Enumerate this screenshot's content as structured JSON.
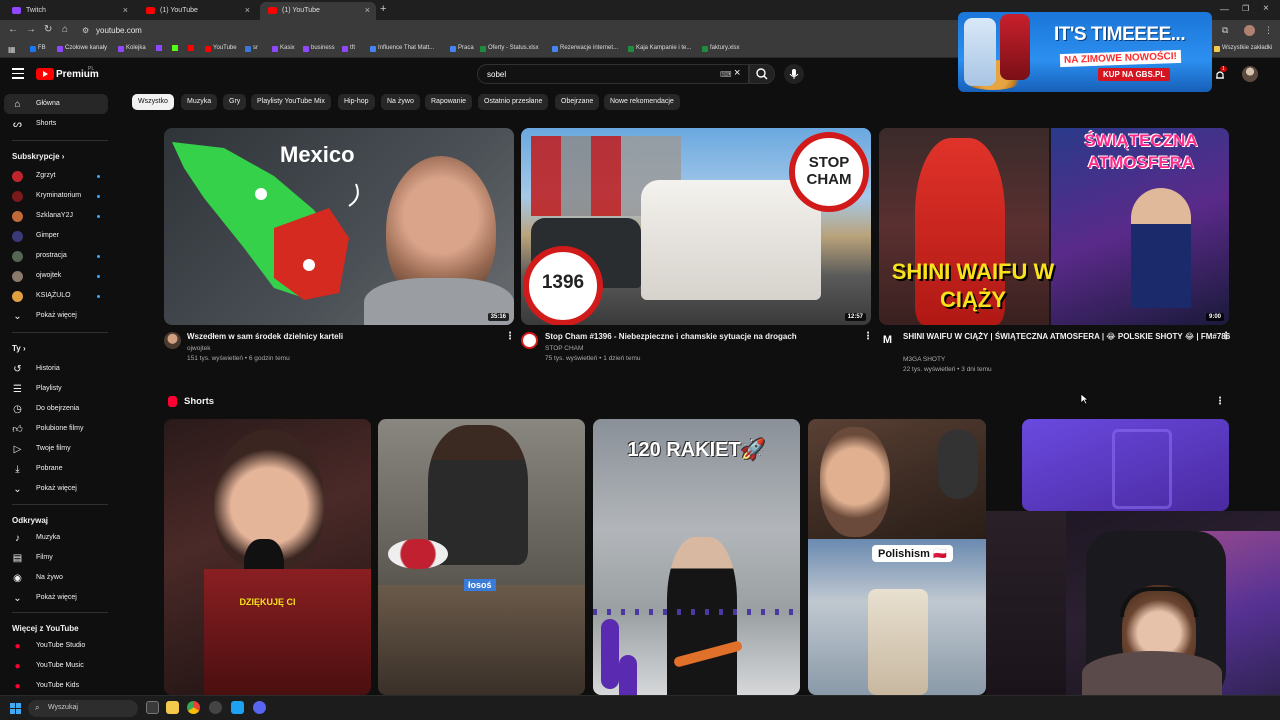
{
  "browser": {
    "tabs": [
      {
        "label": "Twitch",
        "active": false
      },
      {
        "label": "(1) YouTube",
        "active": false
      },
      {
        "label": "(1) YouTube",
        "active": true
      }
    ],
    "url": "youtube.com",
    "bookmarks": [
      "FB",
      "Czołowe kanały",
      "Kolejka",
      "YouTube",
      "sr",
      "Kasix",
      "business",
      "tft",
      "Influence That Matt...",
      "Praca",
      "Oferty - Status.xlsx",
      "Rezerwacje internet...",
      "Kaja Kampanie i te...",
      "faktury.xlsx",
      "Wszystkie zakładki"
    ]
  },
  "header": {
    "logo_text": "Premium",
    "logo_region": "PL",
    "search_value": "sobel",
    "bell_badge": "1"
  },
  "ad": {
    "title": "IT'S TIMEEEE...",
    "subtitle": "NA ZIMOWE NOWOŚCI!",
    "cta": "KUP NA GBS.PL"
  },
  "sidebar": {
    "main": [
      {
        "label": "Główna",
        "icon": "home-icon"
      },
      {
        "label": "Shorts",
        "icon": "shorts-icon"
      }
    ],
    "subs_title": "Subskrypcje",
    "subs": [
      {
        "label": "Zgrzyt",
        "color": "#c0242c",
        "dot": true
      },
      {
        "label": "Kryminatorium",
        "color": "#7a1a1a",
        "dot": true
      },
      {
        "label": "SzklanaY2J",
        "color": "#c06a3a",
        "dot": true
      },
      {
        "label": "Gimper",
        "color": "#3a3a7a",
        "dot": false
      },
      {
        "label": "prostracja",
        "color": "#556655",
        "dot": true
      },
      {
        "label": "ojwojtek",
        "color": "#8a7a6a",
        "dot": true
      },
      {
        "label": "KSIĄŻULO",
        "color": "#e0a040",
        "dot": true
      }
    ],
    "subs_more": "Pokaż więcej",
    "you_title": "Ty",
    "you": [
      {
        "label": "Historia",
        "icon": "history-icon"
      },
      {
        "label": "Playlisty",
        "icon": "playlist-icon"
      },
      {
        "label": "Do obejrzenia",
        "icon": "clock-icon"
      },
      {
        "label": "Polubione filmy",
        "icon": "like-icon"
      },
      {
        "label": "Twoje filmy",
        "icon": "video-icon"
      },
      {
        "label": "Pobrane",
        "icon": "download-icon"
      }
    ],
    "you_more": "Pokaż więcej",
    "explore_title": "Odkrywaj",
    "explore": [
      {
        "label": "Muzyka",
        "icon": "music-icon"
      },
      {
        "label": "Filmy",
        "icon": "film-icon"
      },
      {
        "label": "Na żywo",
        "icon": "live-icon"
      }
    ],
    "explore_more": "Pokaż więcej",
    "more_title": "Więcej z YouTube",
    "more": [
      {
        "label": "YouTube Studio"
      },
      {
        "label": "YouTube Music"
      },
      {
        "label": "YouTube Kids"
      }
    ]
  },
  "chips": [
    "Wszystko",
    "Muzyka",
    "Gry",
    "Playlisty YouTube Mix",
    "Hip-hop",
    "Na żywo",
    "Rapowanie",
    "Ostatnio przesłane",
    "Obejrzane",
    "Nowe rekomendacje"
  ],
  "videos": [
    {
      "title": "Wszedłem w sam środek dzielnicy karteli",
      "channel": "ojwojtek",
      "meta": "151 tys. wyświetleń • 6 godzin temu",
      "duration": "35:16",
      "thumb_text": "Mexico"
    },
    {
      "title": "Stop Cham #1396 - Niebezpieczne i chamskie sytuacje na drogach",
      "channel": "STOP CHAM",
      "meta": "75 tys. wyświetleń • 1 dzień temu",
      "duration": "12:57",
      "thumb_text": "STOP CHAM",
      "thumb_num": "1396"
    },
    {
      "title": "SHINI WAIFU W CIĄŻY | ŚWIĄTECZNA ATMOSFERA | 😂 POLSKIE SHOTY 😂 | FM#786",
      "channel": "M3GA SHOTY",
      "meta": "22 tys. wyświetleń • 3 dni temu",
      "duration": "9:00",
      "thumb_text": "SHINI WAIFU W CIĄŻY",
      "thumb_text2": "ŚWIĄTECZNA ATMOSFERA"
    }
  ],
  "shorts": {
    "label": "Shorts",
    "items": [
      {
        "caption": "DZIĘKUJĘ CI"
      },
      {
        "caption": "łosoś"
      },
      {
        "caption": "120 RAKIET🚀"
      },
      {
        "caption": "Polishism 🇵🇱"
      },
      {
        "caption": ""
      }
    ]
  },
  "taskbar": {
    "search_placeholder": "Wyszukaj"
  }
}
